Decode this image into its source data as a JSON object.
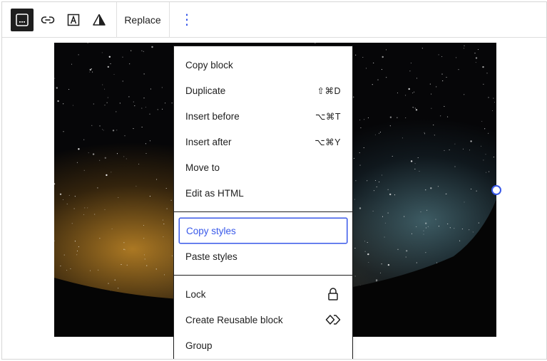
{
  "toolbar": {
    "buttons": [
      {
        "name": "caption-icon",
        "active": true
      },
      {
        "name": "link-icon",
        "active": false
      },
      {
        "name": "text-overlay-icon",
        "active": false
      },
      {
        "name": "duotone-icon",
        "active": false
      }
    ],
    "replace_label": "Replace",
    "more_label": "⋮"
  },
  "menu": {
    "groups": [
      [
        {
          "label": "Copy block",
          "shortcut": ""
        },
        {
          "label": "Duplicate",
          "shortcut": "⇧⌘D"
        },
        {
          "label": "Insert before",
          "shortcut": "⌥⌘T"
        },
        {
          "label": "Insert after",
          "shortcut": "⌥⌘Y"
        },
        {
          "label": "Move to",
          "shortcut": ""
        },
        {
          "label": "Edit as HTML",
          "shortcut": ""
        }
      ],
      [
        {
          "label": "Copy styles",
          "shortcut": "",
          "focused": true
        },
        {
          "label": "Paste styles",
          "shortcut": ""
        }
      ],
      [
        {
          "label": "Lock",
          "icon": "lock-icon"
        },
        {
          "label": "Create Reusable block",
          "icon": "reusable-block-icon"
        },
        {
          "label": "Group",
          "icon": ""
        }
      ]
    ]
  },
  "colors": {
    "accent": "#3858e9",
    "text": "#1e1e1e",
    "active_button_bg": "#1e1e1e"
  }
}
